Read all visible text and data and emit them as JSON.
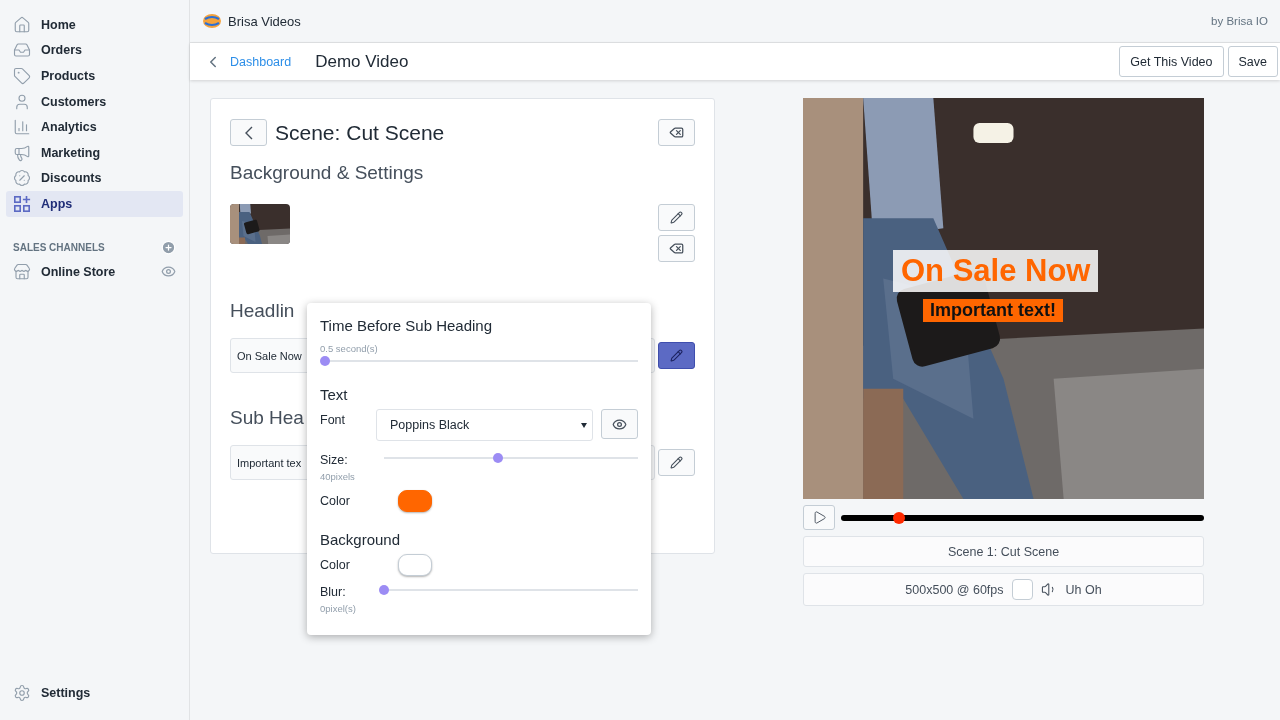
{
  "sidebar": {
    "items": [
      {
        "label": "Home",
        "selected": false
      },
      {
        "label": "Orders",
        "selected": false
      },
      {
        "label": "Products",
        "selected": false
      },
      {
        "label": "Customers",
        "selected": false
      },
      {
        "label": "Analytics",
        "selected": false
      },
      {
        "label": "Marketing",
        "selected": false
      },
      {
        "label": "Discounts",
        "selected": false
      },
      {
        "label": "Apps",
        "selected": true
      }
    ],
    "channels_heading": "SALES CHANNELS",
    "channels": [
      {
        "label": "Online Store"
      }
    ],
    "settings": "Settings"
  },
  "topbar": {
    "app_name": "Brisa Videos",
    "byline": "by Brisa IO"
  },
  "header": {
    "back_link": "Dashboard",
    "title": "Demo Video",
    "buttons": [
      "Get This Video",
      "Save"
    ]
  },
  "editor": {
    "title": "Scene: Cut Scene",
    "section": "Background & Settings",
    "headline_label": "Headlin",
    "headline_value": "On Sale Now",
    "sub_label": "Sub Hea",
    "sub_value": "Important tex"
  },
  "popover": {
    "time_title": "Time Before Sub Heading",
    "time_reading": "0.5 second(s)",
    "time_slider": {
      "level": 0.0
    },
    "text_title": "Text",
    "font_label": "Font",
    "font_value": "Poppins Black",
    "size_label": "Size:",
    "size_reading": "40pixels",
    "size_slider": {
      "level": 0.45
    },
    "color_label": "Color",
    "text_swatch": {
      "color": "#ff6600"
    },
    "bg_title": "Background",
    "bg_color_label": "Color",
    "bg_swatch": {
      "color": "#ffffff"
    },
    "blur_label": "Blur:",
    "blur_reading": "0pixel(s)",
    "blur_slider": {
      "level": 0.0
    }
  },
  "preview": {
    "headline": "On Sale Now",
    "subheading": "Important text!",
    "progress": {
      "level": 0.16
    },
    "scene_button": "Scene 1: Cut Scene",
    "format": "500x500 @ 60fps",
    "checked": false,
    "sound": "Uh Oh"
  }
}
